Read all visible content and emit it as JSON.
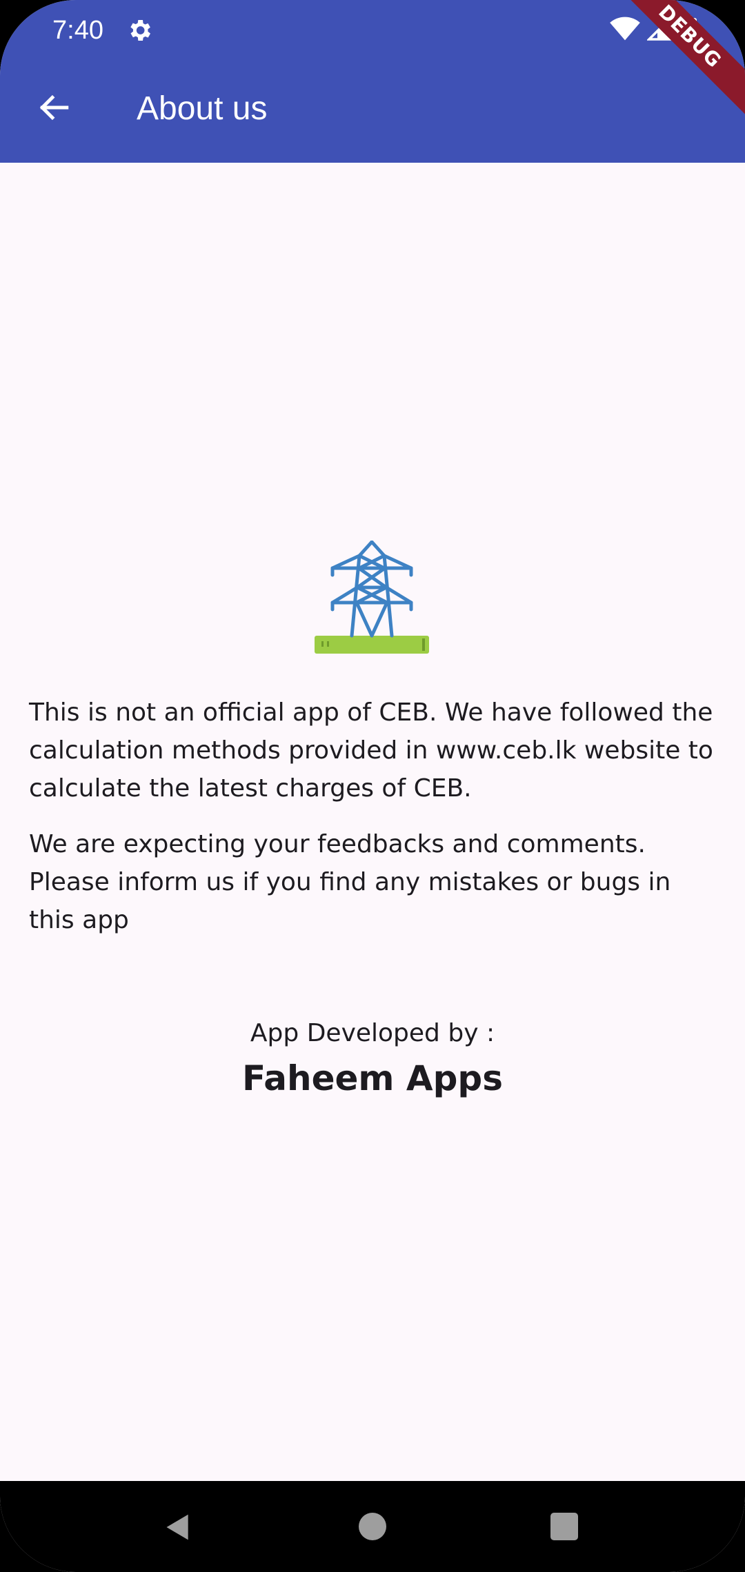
{
  "status_bar": {
    "time": "7:40",
    "icons": [
      "settings-gear-icon",
      "wifi-icon",
      "cell-signal-icon",
      "battery-icon"
    ]
  },
  "app_bar": {
    "title": "About us",
    "back_icon": "arrow-back-icon",
    "background_color": "#3f51b5",
    "debug_banner": "DEBUG"
  },
  "content": {
    "logo_icon": "transmission-tower-icon",
    "paragraphs": [
      "This is not an official app of CEB. We have followed the calculation methods provided in www.ceb.lk website to calculate the latest charges of CEB.",
      "We are expecting your feedbacks and comments. Please inform us if you find any mistakes or bugs in this app"
    ],
    "developer_label": "App Developed by :",
    "developer_name": "Faheem Apps"
  },
  "nav_bar": {
    "buttons": [
      "nav-back-icon",
      "nav-home-icon",
      "nav-recents-icon"
    ]
  }
}
